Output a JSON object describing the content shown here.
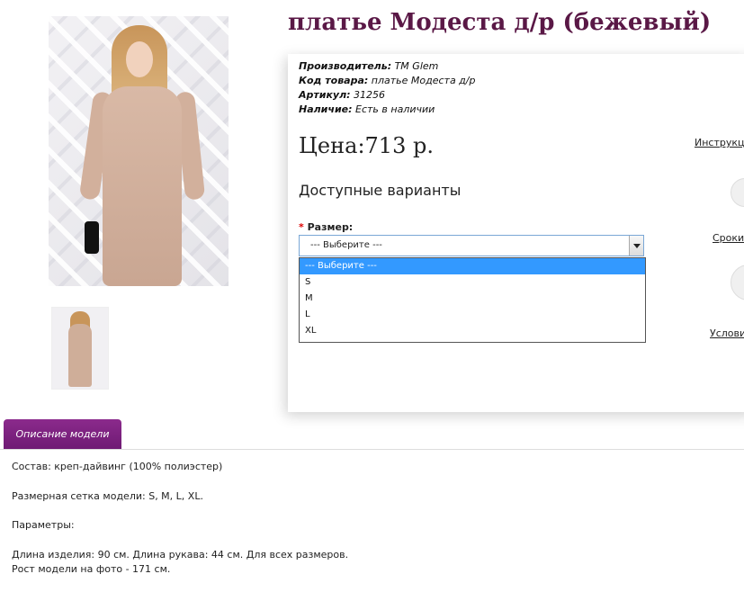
{
  "product": {
    "title": "платье Модеста д/р (бежевый)",
    "meta": [
      {
        "label": "Производитель:",
        "value": " TM Glem"
      },
      {
        "label": "Код товара:",
        "value": " платье Модеста д/р"
      },
      {
        "label": "Артикул:",
        "value": " 31256"
      },
      {
        "label": "Наличие:",
        "value": " Есть в наличии"
      }
    ],
    "price": "Цена:713 р.",
    "variants_heading": "Доступные варианты",
    "size_label": "Размер:",
    "size_required_mark": "*",
    "size_select_value": "--- Выберите ---",
    "size_options": [
      "--- Выберите ---",
      "S",
      "M",
      "L",
      "XL"
    ]
  },
  "side_links": {
    "instructions": "Инструкц",
    "terms": "Сроки",
    "conditions": "Услови"
  },
  "tabs": {
    "description": "Описание модели"
  },
  "description": {
    "composition": "Состав: креп-дайвинг (100% полиэстер)",
    "size_grid": "Размерная сетка модели: S, M, L, XL.",
    "params_heading": "Параметры:",
    "length": "Длина изделия: 90 см. Длина рукава: 44 см. Для всех размеров.",
    "model_height": "Рост модели на фото - 171 см."
  },
  "colors": {
    "title": "#5a1846",
    "tab": "#7b1f7f",
    "selected_option": "#3399ff"
  }
}
